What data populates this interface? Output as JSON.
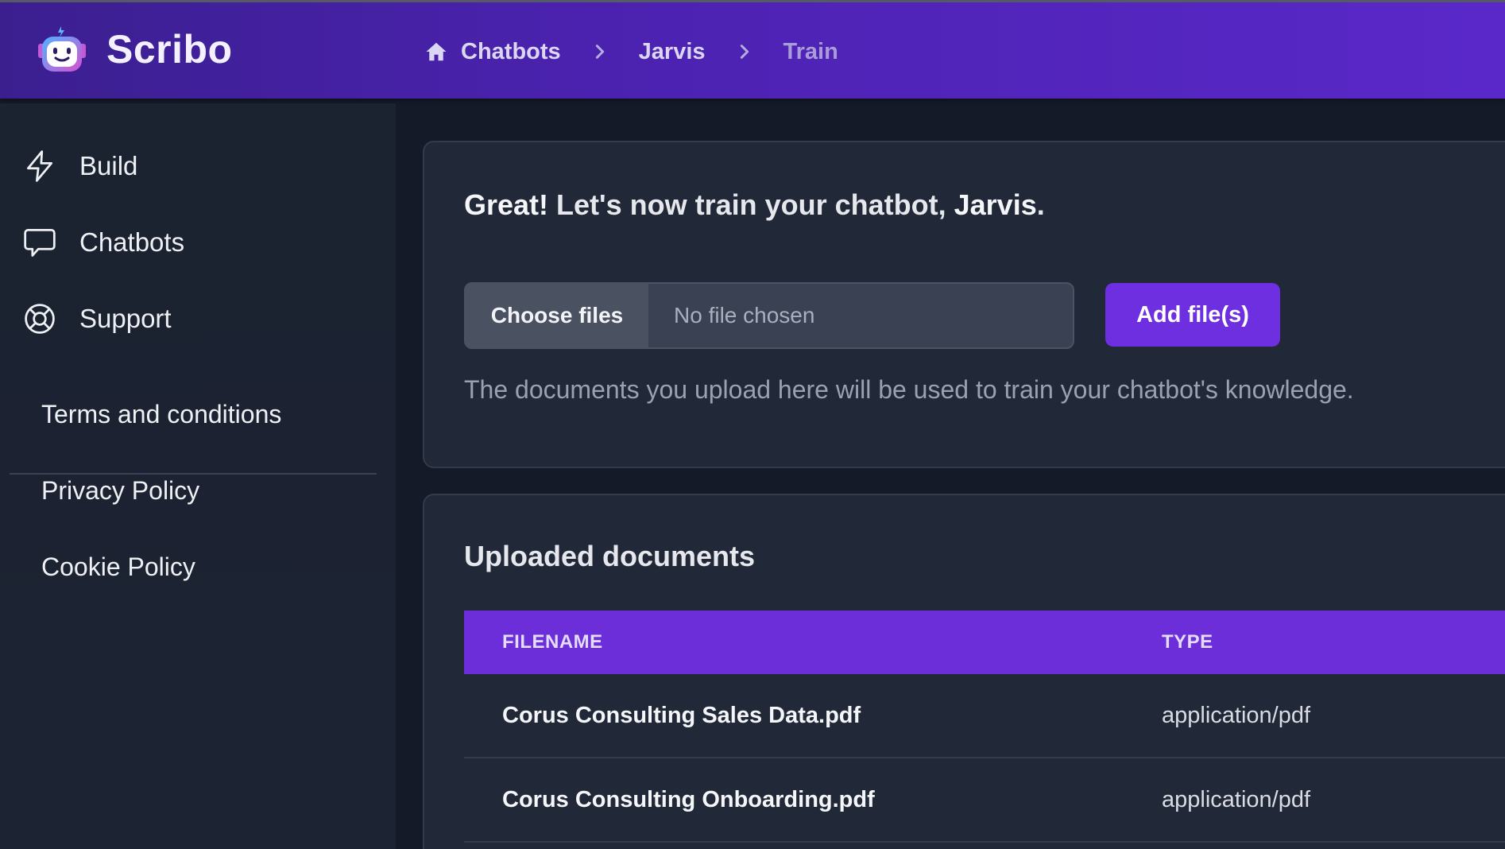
{
  "app": {
    "name": "Scribo"
  },
  "breadcrumb": {
    "items": [
      {
        "label": "Chatbots"
      },
      {
        "label": "Jarvis"
      }
    ],
    "current": "Train"
  },
  "sidebar": {
    "nav": [
      {
        "label": "Build",
        "icon": "lightning-icon"
      },
      {
        "label": "Chatbots",
        "icon": "chat-bubble-icon"
      },
      {
        "label": "Support",
        "icon": "lifebuoy-icon"
      }
    ],
    "legal": [
      {
        "label": "Terms and conditions"
      },
      {
        "label": "Privacy Policy"
      },
      {
        "label": "Cookie Policy"
      }
    ]
  },
  "train": {
    "headline_strong": "Great!",
    "headline_text": " Let's now train your chatbot, ",
    "bot_name": "Jarvis",
    "headline_end": ".",
    "choose_label": "Choose files",
    "file_status": "No file chosen",
    "add_label": "Add file(s)",
    "helper": "The documents you upload here will be used to train your chatbot's knowledge."
  },
  "documents": {
    "title": "Uploaded documents",
    "columns": [
      "FILENAME",
      "TYPE"
    ],
    "rows": [
      {
        "filename": "Corus Consulting Sales Data.pdf",
        "type": "application/pdf"
      },
      {
        "filename": "Corus Consulting Onboarding.pdf",
        "type": "application/pdf"
      }
    ]
  },
  "colors": {
    "header_gradient_start": "#3b1f8f",
    "header_gradient_end": "#5a28c9",
    "accent": "#6d2fe0",
    "table_header": "#6b2ed8",
    "background": "#141a27",
    "card": "#212837"
  }
}
